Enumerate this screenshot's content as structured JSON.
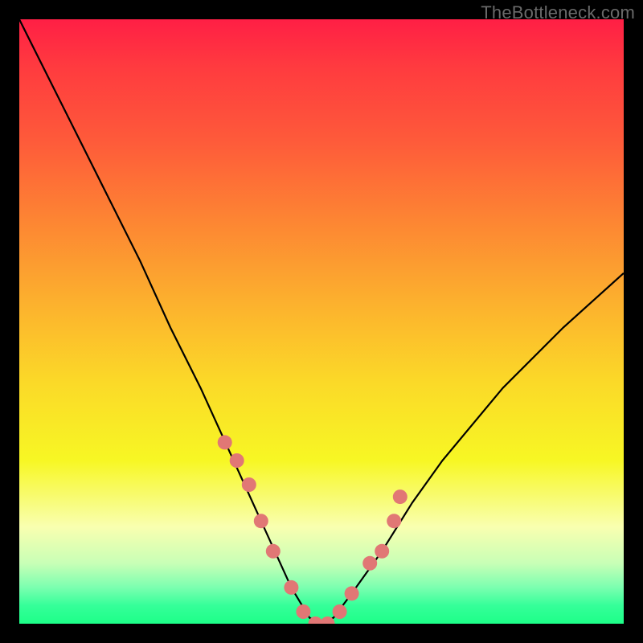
{
  "attribution": "TheBottleneck.com",
  "chart_data": {
    "type": "line",
    "title": "",
    "xlabel": "",
    "ylabel": "",
    "xlim": [
      0,
      100
    ],
    "ylim": [
      0,
      100
    ],
    "series": [
      {
        "name": "bottleneck-curve",
        "x": [
          0,
          5,
          10,
          15,
          20,
          25,
          30,
          35,
          40,
          45,
          48,
          50,
          52,
          55,
          60,
          65,
          70,
          80,
          90,
          100
        ],
        "values": [
          100,
          90,
          80,
          70,
          60,
          49,
          39,
          28,
          17,
          6,
          1,
          0,
          1,
          5,
          12,
          20,
          27,
          39,
          49,
          58
        ]
      }
    ],
    "markers": {
      "name": "highlighted-points",
      "color": "#e17775",
      "x": [
        34,
        36,
        38,
        40,
        42,
        45,
        47,
        49,
        51,
        53,
        55,
        58,
        60,
        62,
        63
      ],
      "y": [
        30,
        27,
        23,
        17,
        12,
        6,
        2,
        0,
        0,
        2,
        5,
        10,
        12,
        17,
        21
      ]
    }
  }
}
